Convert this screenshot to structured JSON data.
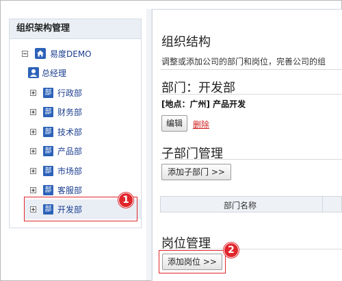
{
  "sidebar": {
    "title": "组织架构管理",
    "root": {
      "label": "易度DEMO",
      "toggle": "collapse"
    },
    "manager": {
      "label": "总经理"
    },
    "dept_icon_text": "部",
    "departments": [
      {
        "label": "行政部"
      },
      {
        "label": "财务部"
      },
      {
        "label": "技术部"
      },
      {
        "label": "产品部"
      },
      {
        "label": "市场部"
      },
      {
        "label": "客服部"
      },
      {
        "label": "开发部",
        "selected": true
      }
    ]
  },
  "main": {
    "heading": "组织结构",
    "description": "调整或添加公司的部门和岗位，完善公司的组",
    "department": {
      "heading": "部门：开发部",
      "location_line": "[地点：广州] 产品开发",
      "edit_label": "编辑",
      "delete_label": "删除"
    },
    "sub_departments": {
      "heading": "子部门管理",
      "add_label": "添加子部门 >>",
      "table_headers": [
        "部门名称"
      ]
    },
    "positions": {
      "heading": "岗位管理",
      "add_label": "添加岗位 >>"
    }
  },
  "annotations": [
    {
      "number": "1"
    },
    {
      "number": "2"
    }
  ],
  "colors": {
    "accent_red": "#e0252b",
    "link_blue": "#1a3d8f",
    "dept_icon_blue": "#2d62b8",
    "panel_header_bg": "#eaeff5"
  }
}
